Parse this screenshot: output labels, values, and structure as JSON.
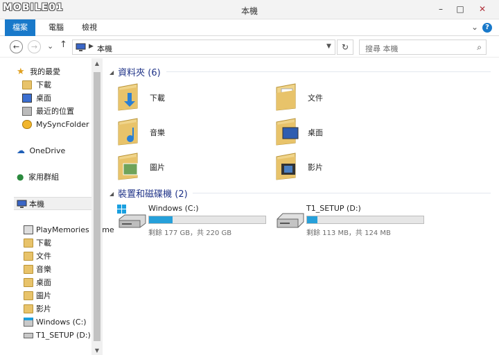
{
  "window": {
    "watermark": "MOBILE01",
    "title": "本機",
    "buttons": [
      "–",
      "□",
      "✕"
    ]
  },
  "ribbon": {
    "tabs": [
      "檔案",
      "電腦",
      "檢視"
    ],
    "help": "?"
  },
  "address": {
    "path": "本機",
    "search_placeholder": "搜尋 本機"
  },
  "sidebar": {
    "favorites": {
      "label": "我的最愛",
      "items": [
        "下載",
        "桌面",
        "最近的位置",
        "MySyncFolder"
      ]
    },
    "onedrive": "OneDrive",
    "homegroup": "家用群組",
    "thispc": "本機",
    "pc_items": [
      "PlayMemories Home",
      "下載",
      "文件",
      "音樂",
      "桌面",
      "圖片",
      "影片",
      "Windows (C:)",
      "T1_SETUP (D:)"
    ]
  },
  "content": {
    "folders_header": "資料夾 (6)",
    "folders": [
      "下載",
      "文件",
      "音樂",
      "桌面",
      "圖片",
      "影片"
    ],
    "drives_header": "裝置和磁碟機 (2)",
    "drives": [
      {
        "name": "Windows (C:)",
        "info": "剩餘 177 GB，共 220 GB",
        "used_fraction": 0.2
      },
      {
        "name": "T1_SETUP (D:)",
        "info": "剩餘 113 MB，共 124 MB",
        "used_fraction": 0.09
      }
    ]
  },
  "colors": {
    "accent": "#1979ca",
    "drive_bar": "#26a0da",
    "group_header": "#1e3287",
    "folder": "#e8c36a"
  }
}
